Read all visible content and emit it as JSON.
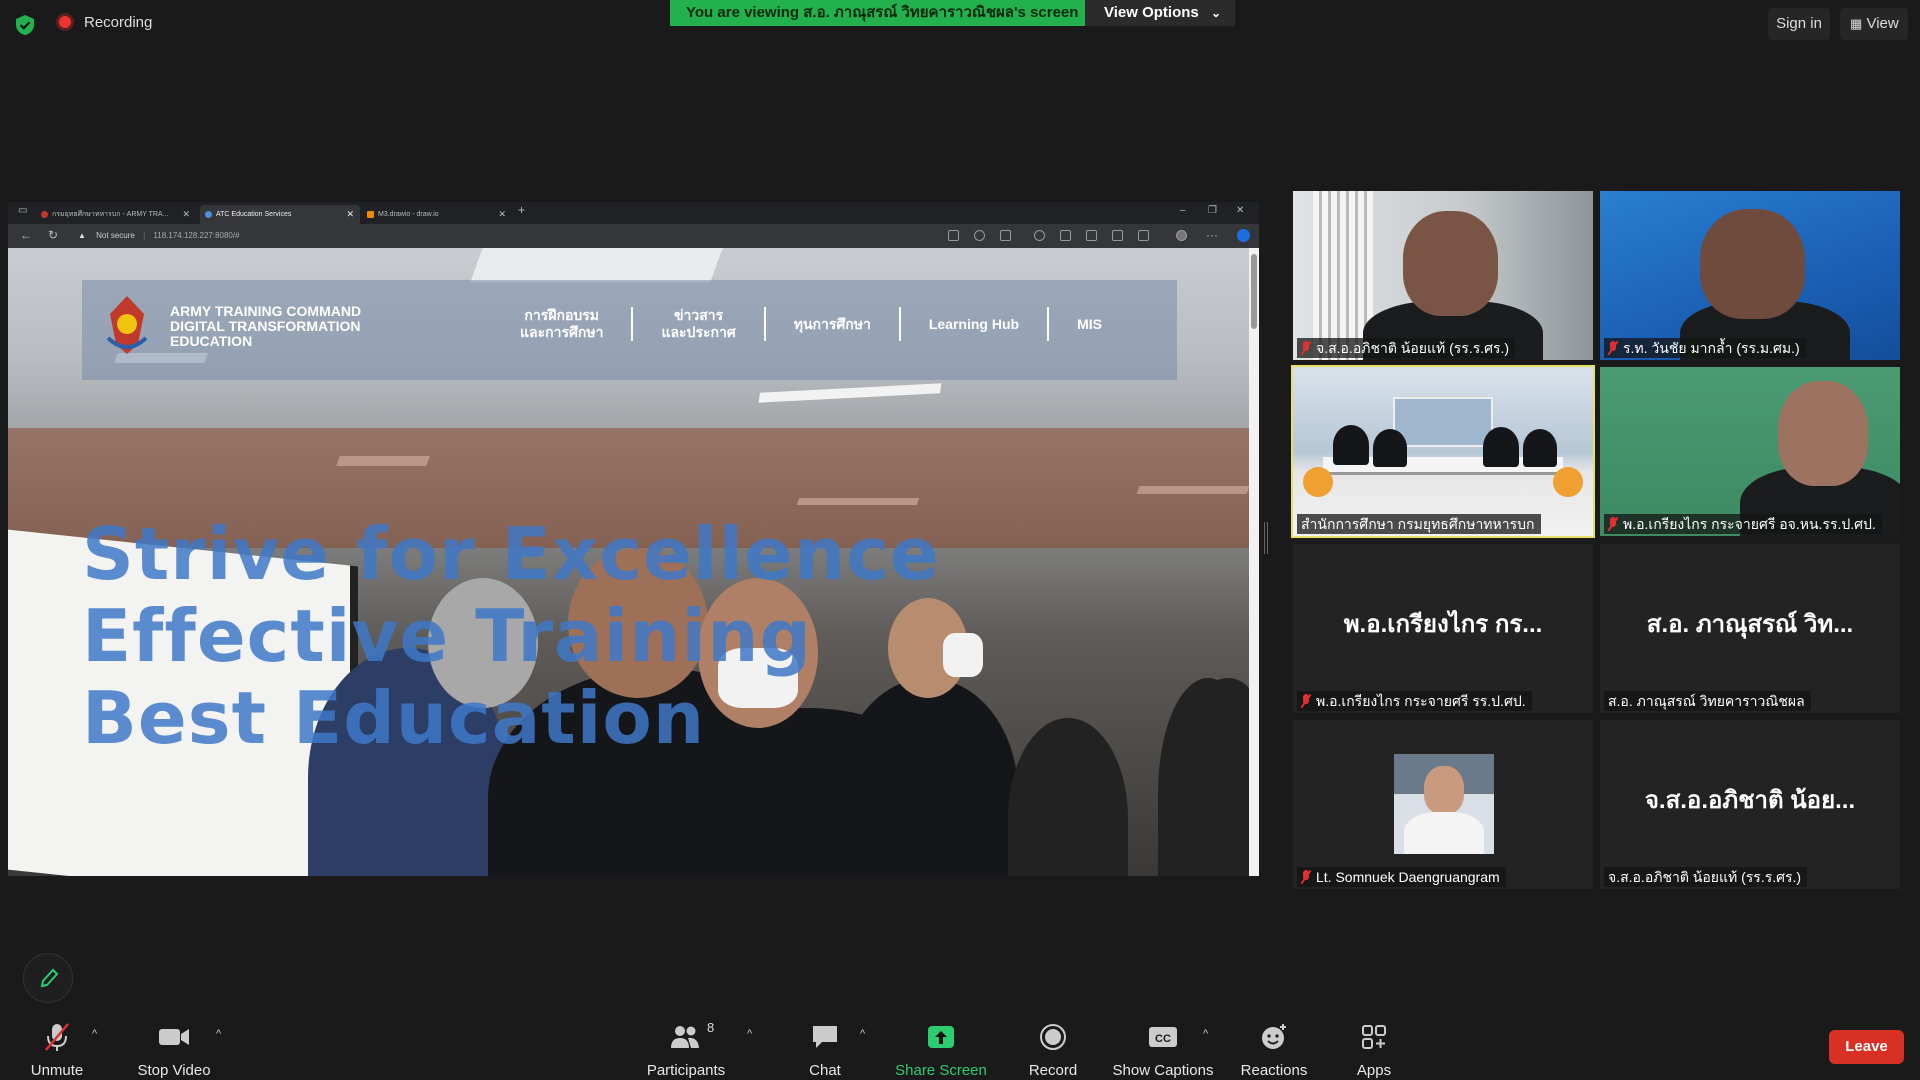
{
  "topbar": {
    "recording_label": "Recording",
    "viewing_banner": "You  are  viewing  ส.อ. ภาณุสรณ์  วิทยคาราวณิชผล's  screen",
    "view_options_label": "View Options",
    "sign_in_label": "Sign in",
    "view_label": "View"
  },
  "browser": {
    "tabs": [
      "กรมยุทธศึกษาทหารบก - ARMY TRA...",
      "ATC Education Services",
      "M3.drawio - draw.io"
    ],
    "security_label": "Not secure",
    "url": "118.174.128.227:8080/#"
  },
  "website": {
    "brand_line1": "ARMY TRAINING COMMAND",
    "brand_line2": "DIGITAL TRANSFORMATION",
    "brand_line3": "EDUCATION",
    "nav": [
      {
        "line1": "การฝึกอบรม",
        "line2": "และการศึกษา"
      },
      {
        "line1": "ข่าวสาร",
        "line2": "และประกาศ"
      },
      {
        "line1": "ทุนการศึกษา",
        "line2": ""
      },
      {
        "line1": "Learning Hub",
        "line2": ""
      },
      {
        "line1": "MIS",
        "line2": ""
      }
    ],
    "hero_line1": "Strive for Excellence",
    "hero_line2": "Effective Training",
    "hero_line3": "Best Education"
  },
  "gallery": [
    {
      "name": "จ.ส.อ.อภิชาติ  น้อยแท้ (รร.ร.ศร.)",
      "muted": true,
      "kind": "video"
    },
    {
      "name": "ร.ท. วันชัย  มากล้ำ (รร.ม.ศม.)",
      "muted": true,
      "kind": "video"
    },
    {
      "name": "สำนักการศึกษา กรมยุทธศึกษาทหารบก",
      "muted": false,
      "kind": "video"
    },
    {
      "name": "พ.อ.เกรียงไกร กระจายศรี อจ.หน.รร.ป.ศป.",
      "muted": true,
      "kind": "video"
    },
    {
      "name": "พ.อ.เกรียงไกร กระจายศรี รร.ป.ศป.",
      "display": "พ.อ.เกรียงไกร กร...",
      "muted": true,
      "kind": "name"
    },
    {
      "name": "ส.อ. ภาณุสรณ์ วิทยคาราวณิชผล",
      "display": "ส.อ. ภาณุสรณ์ วิท...",
      "muted": false,
      "kind": "name"
    },
    {
      "name": "Lt. Somnuek Daengruangram",
      "muted": true,
      "kind": "avatar"
    },
    {
      "name": "จ.ส.อ.อภิชาติ น้อยแท้ (รร.ร.ศร.)",
      "display": "จ.ส.อ.อภิชาติ น้อย...",
      "muted": false,
      "kind": "name"
    }
  ],
  "toolbar": {
    "unmute": "Unmute",
    "stop_video": "Stop Video",
    "participants": "Participants",
    "participants_count": "8",
    "chat": "Chat",
    "share_screen": "Share Screen",
    "record": "Record",
    "show_captions": "Show Captions",
    "captions_badge": "CC",
    "reactions": "Reactions",
    "apps": "Apps",
    "leave": "Leave"
  },
  "colors": {
    "share_green": "#23b14d",
    "leave_red": "#d93025",
    "active_speaker": "#e8e06a"
  }
}
